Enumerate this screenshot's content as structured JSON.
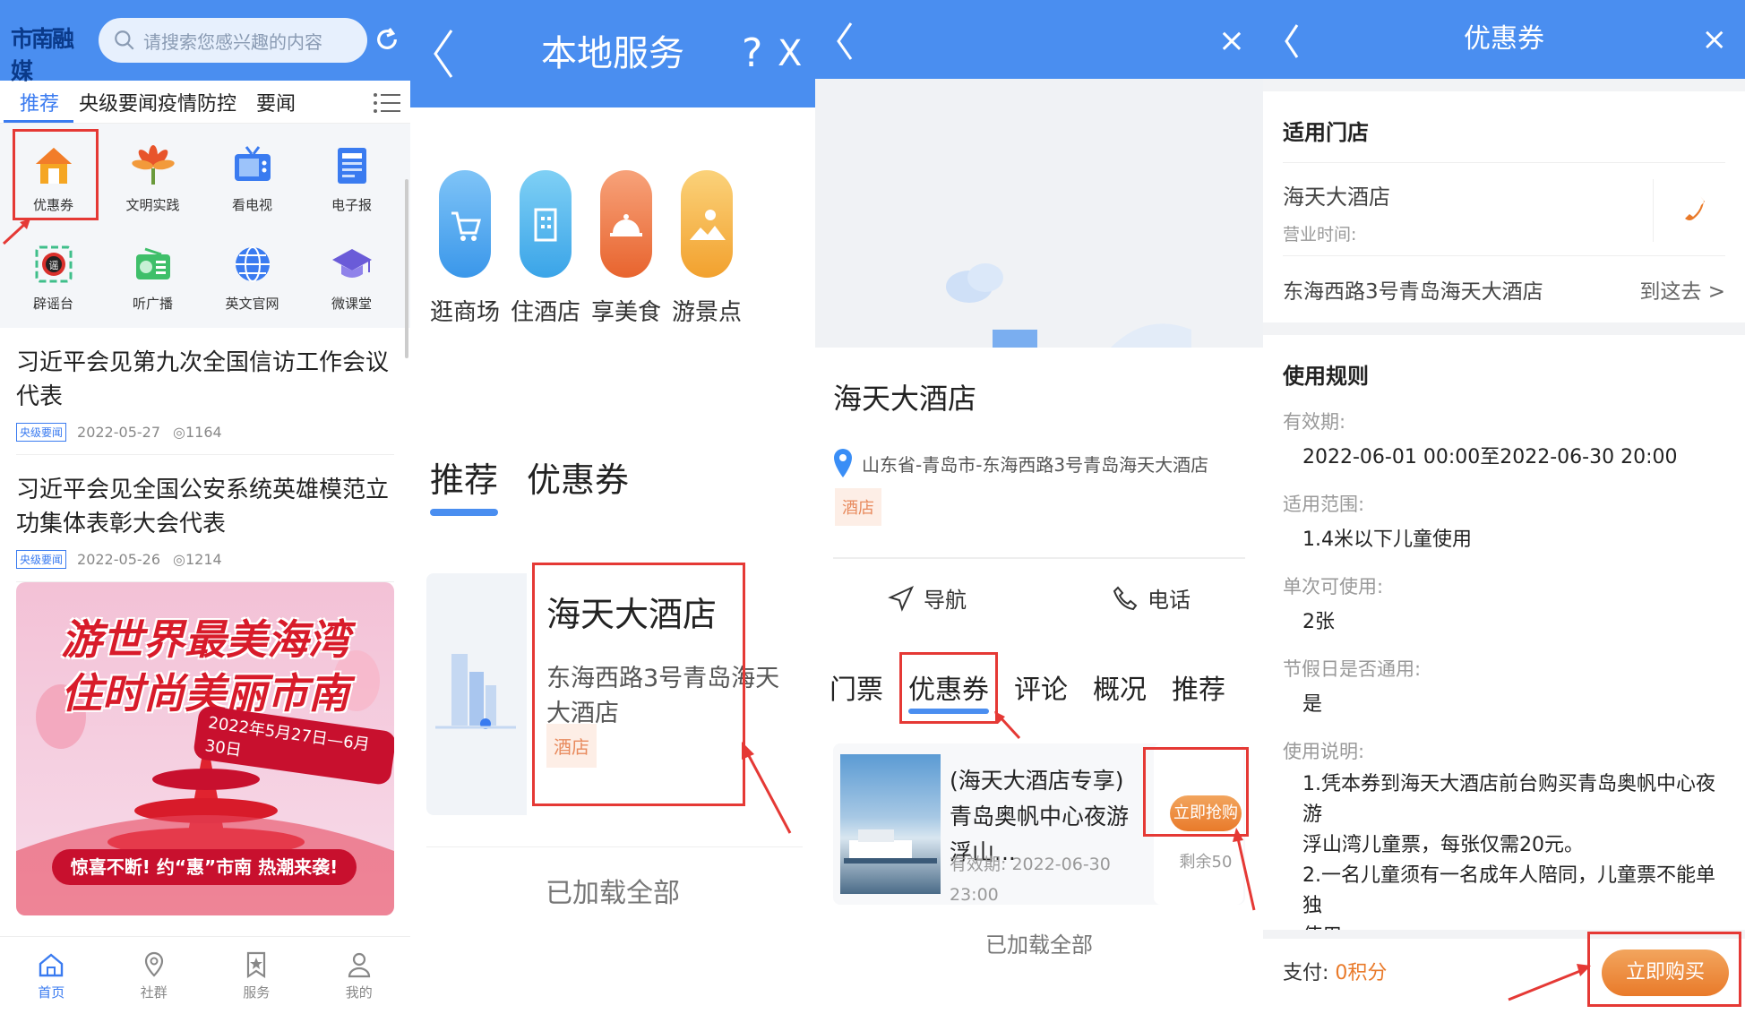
{
  "p1": {
    "logo": "市南融媒",
    "search_placeholder": "请搜索您感兴趣的内容",
    "tabs": [
      "推荐",
      "央级要闻",
      "疫情防控",
      "要闻"
    ],
    "grid": [
      {
        "label": "优惠券",
        "icon": "house-icon"
      },
      {
        "label": "文明实践",
        "icon": "flower-icon"
      },
      {
        "label": "看电视",
        "icon": "tv-icon"
      },
      {
        "label": "电子报",
        "icon": "newspaper-icon"
      },
      {
        "label": "辟谣台",
        "icon": "rumor-icon"
      },
      {
        "label": "听广播",
        "icon": "radio-icon"
      },
      {
        "label": "英文官网",
        "icon": "globe-icon"
      },
      {
        "label": "微课堂",
        "icon": "graduation-cap-icon"
      }
    ],
    "news": [
      {
        "title": "习近平会见第九次全国信访工作会议代表",
        "badge": "央级要闻",
        "date": "2022-05-27",
        "views": "1164"
      },
      {
        "title": "习近平会见全国公安系统英雄模范立功集体表彰大会代表",
        "badge": "央级要闻",
        "date": "2022-05-26",
        "views": "1214"
      }
    ],
    "banner": {
      "line1": "游世界最美海湾",
      "line2": "住时尚美丽市南",
      "date": "2022年5月27日—6月30日",
      "bottom": "惊喜不断! 约“惠”市南 热潮来袭!"
    },
    "nav": [
      "首页",
      "社群",
      "服务",
      "我的"
    ]
  },
  "p2": {
    "title": "本地服务",
    "help": "?",
    "close": "X",
    "categories": [
      "逛商场",
      "住酒店",
      "享美食",
      "游景点"
    ],
    "subtabs": [
      "推荐",
      "优惠券"
    ],
    "card": {
      "name": "海天大酒店",
      "address": "东海西路3号青岛海天大酒店",
      "tag": "酒店"
    },
    "loaded": "已加载全部"
  },
  "p3": {
    "close": "×",
    "name": "海天大酒店",
    "location": "山东省-青岛市-东海西路3号青岛海天大酒店",
    "tag": "酒店",
    "actions": [
      "导航",
      "电话"
    ],
    "tabs": [
      "门票",
      "优惠券",
      "评论",
      "概况",
      "推荐"
    ],
    "coupon": {
      "title": "(海天大酒店专享) 青岛奥帆中心夜游浮山...",
      "validity_line1": "有效期: 2022-06-30",
      "validity_line2": "23:00",
      "grab": "立即抢购",
      "remain": "剩余50"
    },
    "loaded": "已加载全部"
  },
  "p4": {
    "title": "优惠券",
    "close": "×",
    "store_section": "适用门店",
    "store_name": "海天大酒店",
    "hours_label": "营业时间:",
    "address": "东海西路3号青岛海天大酒店",
    "go": "到这去 >",
    "rules_section": "使用规则",
    "validity_label": "有效期:",
    "validity_value": "2022-06-01 00:00至2022-06-30 20:00",
    "scope_label": "适用范围:",
    "scope_value": "1.4米以下儿童使用",
    "per_use_label": "单次可使用:",
    "per_use_value": "2张",
    "holiday_label": "节假日是否通用:",
    "holiday_value": "是",
    "desc_label": "使用说明:",
    "desc_lines": [
      "1.凭本券到海天大酒店前台购买青岛奥帆中心夜游",
      "浮山湾儿童票，每张仅需20元。",
      "2.一名儿童须有一名成年人陪同，儿童票不能单独",
      "使用。"
    ],
    "pay_label": "支付: ",
    "pay_points": "0积分",
    "buy": "立即购买"
  },
  "colors": {
    "primary": "#4a8ef0",
    "highlight": "#e53935",
    "accent": "#e97a2a"
  }
}
